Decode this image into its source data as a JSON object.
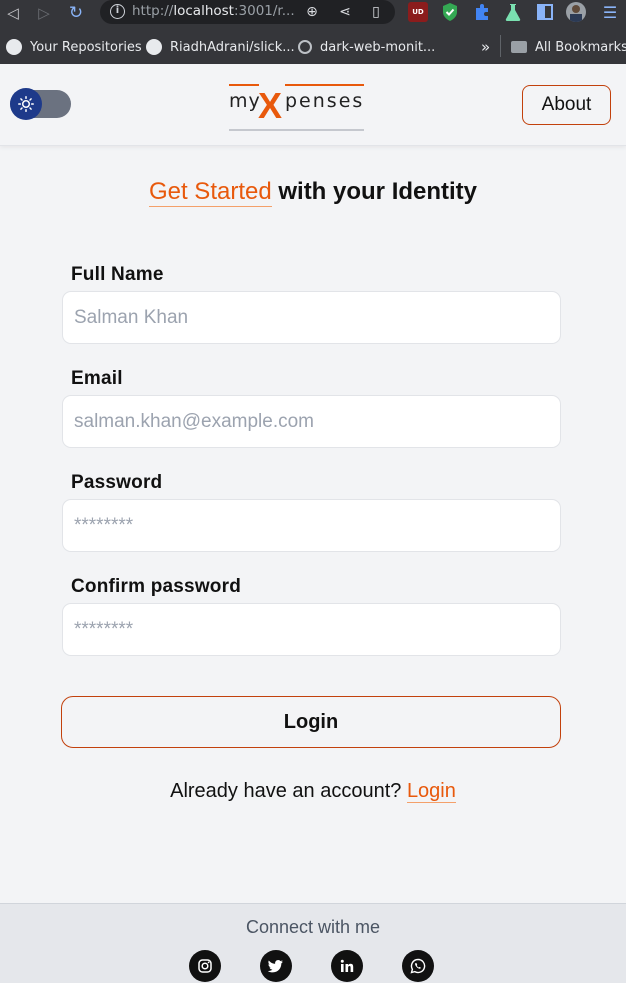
{
  "browser": {
    "url_prefix": "http://",
    "url_host": "localhost",
    "url_rest": ":3001/r...",
    "bookmarks": [
      {
        "label": "Your Repositories"
      },
      {
        "label": "RiadhAdrani/slick..."
      },
      {
        "label": "dark-web-monit..."
      }
    ],
    "more_bookmarks": "»",
    "all_bookmarks": "All Bookmarks",
    "ext_badge": "UD"
  },
  "header": {
    "logo": {
      "my": "my",
      "x": "X",
      "penses": "penses"
    },
    "about_label": "About"
  },
  "main": {
    "heading_accent": "Get Started",
    "heading_rest": " with your Identity",
    "fields": [
      {
        "label": "Full Name",
        "placeholder": "Salman Khan",
        "type": "text"
      },
      {
        "label": "Email",
        "placeholder": "salman.khan@example.com",
        "type": "email"
      },
      {
        "label": "Password",
        "placeholder": "********",
        "type": "password"
      },
      {
        "label": "Confirm password",
        "placeholder": "********",
        "type": "password"
      }
    ],
    "submit_label": "Login",
    "already_text": "Already have an account? ",
    "already_link": "Login"
  },
  "footer": {
    "connect_text": "Connect with me",
    "socials": [
      {
        "icon": "instagram-icon"
      },
      {
        "icon": "twitter-icon"
      },
      {
        "icon": "linkedin-icon"
      },
      {
        "icon": "whatsapp-icon"
      }
    ]
  },
  "colors": {
    "accent": "#e8590c",
    "button_border": "#c2410c",
    "background": "#f3f4f6",
    "toggle_knob": "#1e3a8a"
  }
}
